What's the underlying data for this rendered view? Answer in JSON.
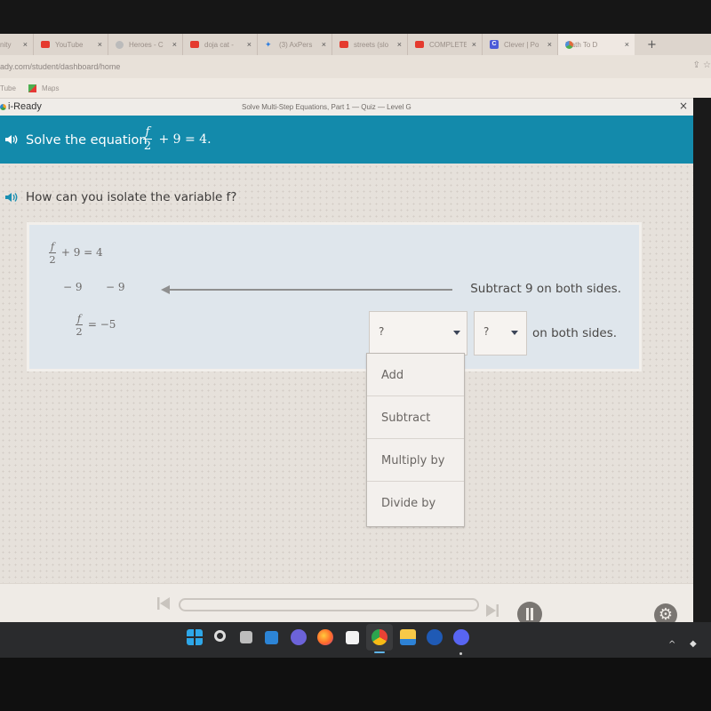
{
  "browser": {
    "tabs": [
      {
        "title": "nity",
        "icon": "generic-icon",
        "active": false
      },
      {
        "title": "YouTube",
        "icon": "youtube-icon",
        "active": false
      },
      {
        "title": "Heroes - C",
        "icon": "heroes-icon",
        "active": false
      },
      {
        "title": "doja cat -",
        "icon": "youtube-icon",
        "active": false
      },
      {
        "title": "(3) AxPers",
        "icon": "twitter-icon",
        "active": false
      },
      {
        "title": "streets (slo",
        "icon": "youtube-icon",
        "active": false
      },
      {
        "title": "COMPLETE",
        "icon": "youtube-icon",
        "active": false
      },
      {
        "title": "Clever | Po",
        "icon": "clever-icon",
        "active": false
      },
      {
        "title": "Math To D",
        "icon": "math-icon",
        "active": true
      }
    ],
    "new_tab_label": "+",
    "close_glyph": "×",
    "url": "ady.com/student/dashboard/home",
    "bookmarks": [
      {
        "label": "Tube"
      },
      {
        "label": "Maps"
      }
    ]
  },
  "app": {
    "logo": "i-Ready",
    "lesson_title": "Solve Multi-Step Equations, Part 1 — Quiz — Level G",
    "close_glyph": "×"
  },
  "prompt": {
    "text": "Solve the equation",
    "equation": {
      "numerator": "f",
      "denominator": "2",
      "rest": "+ 9 = 4."
    }
  },
  "question": {
    "text": "How can you isolate the variable f?"
  },
  "work": {
    "line1": {
      "numerator": "f",
      "denominator": "2",
      "rest": "+ 9 = 4"
    },
    "line2": {
      "left": "− 9",
      "right": "− 9"
    },
    "line3": {
      "numerator": "f",
      "denominator": "2",
      "rest": "= −5"
    },
    "step1_text": "Subtract 9 on both sides.",
    "step2_suffix": "on both sides.",
    "operation_select": {
      "value": "?"
    },
    "number_select": {
      "value": "?"
    }
  },
  "dropdown": {
    "options": [
      "Add",
      "Subtract",
      "Multiply by",
      "Divide by"
    ]
  },
  "player": {
    "progress": 0,
    "state": "paused-control-visible"
  },
  "taskbar": {
    "apps": [
      "start",
      "search",
      "task-view",
      "widgets",
      "teams-chat",
      "firefox",
      "microsoft-store",
      "chrome",
      "file-explorer",
      "app-blue",
      "discord"
    ],
    "active_app": "chrome"
  }
}
